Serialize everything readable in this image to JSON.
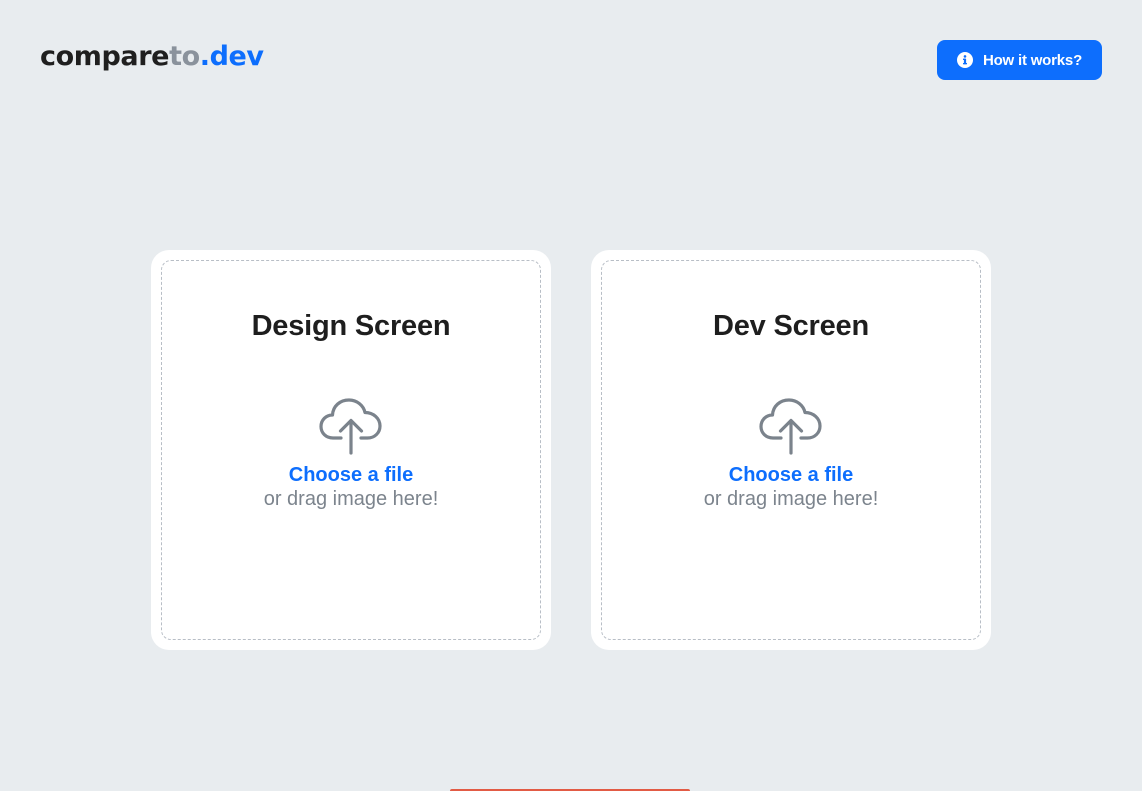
{
  "header": {
    "logo": {
      "part1": "compare",
      "part2": "to",
      "part3": ".dev"
    },
    "help_button": {
      "label": "How it works?",
      "icon": "info-icon"
    }
  },
  "cards": [
    {
      "title": "Design Screen",
      "icon": "cloud-upload-icon",
      "choose_label": "Choose a file",
      "hint": "or drag image here!"
    },
    {
      "title": "Dev Screen",
      "icon": "cloud-upload-icon",
      "choose_label": "Choose a file",
      "hint": "or drag image here!"
    }
  ],
  "colors": {
    "accent": "#0d6efd",
    "background": "#e8ecef",
    "muted_text": "#7c848d",
    "bottom_strip": "#e25b45"
  }
}
